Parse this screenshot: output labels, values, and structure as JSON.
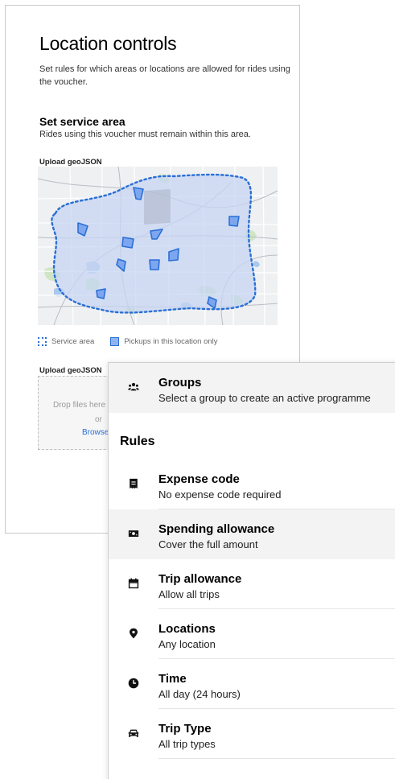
{
  "location_controls": {
    "title": "Location controls",
    "description": "Set rules for which areas or locations are allowed for rides using the voucher.",
    "service_area": {
      "title": "Set service area",
      "description": "Rides using this voucher must remain within this area."
    },
    "upload_label_1": "Upload geoJSON",
    "legend": {
      "service_area": "Service area",
      "pickups": "Pickups in this location only"
    },
    "upload_label_2": "Upload geoJSON",
    "dropzone": {
      "line1": "Drop files here",
      "line2": "or",
      "line3": "Browse files"
    }
  },
  "rules_panel": {
    "groups": {
      "icon": "people-icon",
      "title": "Groups",
      "subtitle": "Select a group to create an active programme"
    },
    "heading": "Rules",
    "items": [
      {
        "icon": "receipt-icon",
        "title": "Expense code",
        "subtitle": "No expense code required"
      },
      {
        "icon": "cash-icon",
        "title": "Spending allowance",
        "subtitle": "Cover the full amount"
      },
      {
        "icon": "calendar-icon",
        "title": "Trip allowance",
        "subtitle": "Allow all trips"
      },
      {
        "icon": "location-pin-icon",
        "title": "Locations",
        "subtitle": "Any location"
      },
      {
        "icon": "clock-icon",
        "title": "Time",
        "subtitle": "All day (24 hours)"
      },
      {
        "icon": "car-icon",
        "title": "Trip Type",
        "subtitle": "All trip types"
      }
    ]
  },
  "colors": {
    "accent": "#2a6fd6",
    "service_area_fill": "#c7d6f3",
    "row_highlight": "#f3f3f3"
  }
}
